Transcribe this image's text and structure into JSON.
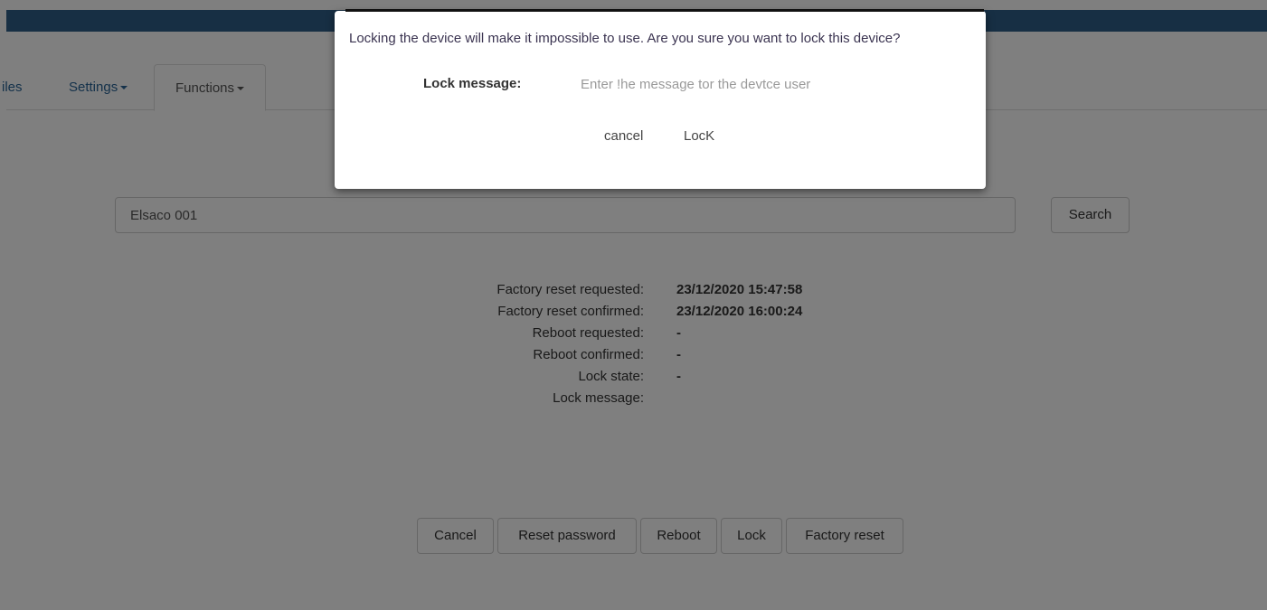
{
  "nav": {
    "tabs": [
      {
        "label": "iles"
      },
      {
        "label": "Settings"
      },
      {
        "label": "Functions"
      }
    ]
  },
  "search": {
    "value": "Elsaco 001",
    "button_label": "Search"
  },
  "device_info": {
    "rows": [
      {
        "label": "Factory reset requested:",
        "value": "23/12/2020 15:47:58"
      },
      {
        "label": "Factory reset confirmed:",
        "value": "23/12/2020 16:00:24"
      },
      {
        "label": "Reboot requested:",
        "value": "-"
      },
      {
        "label": "Reboot confirmed:",
        "value": "-"
      },
      {
        "label": "Lock state:",
        "value": "-"
      },
      {
        "label": "Lock message:",
        "value": ""
      }
    ]
  },
  "actions": {
    "cancel": "Cancel",
    "reset_password": "Reset password",
    "reboot": "Reboot",
    "lock": "Lock",
    "factory_reset": "Factory reset"
  },
  "modal": {
    "message": "Locking the device will make it impossible to use. Are you sure you want to lock this device?",
    "lock_label": "Lock message:",
    "lock_placeholder": "Enter !he message tor the devtce user",
    "cancel_label": "cancel",
    "lock_button_label": "LocK"
  },
  "colors": {
    "topbar": "#2f5e88",
    "overlay": "rgba(0,0,0,0.5)"
  }
}
